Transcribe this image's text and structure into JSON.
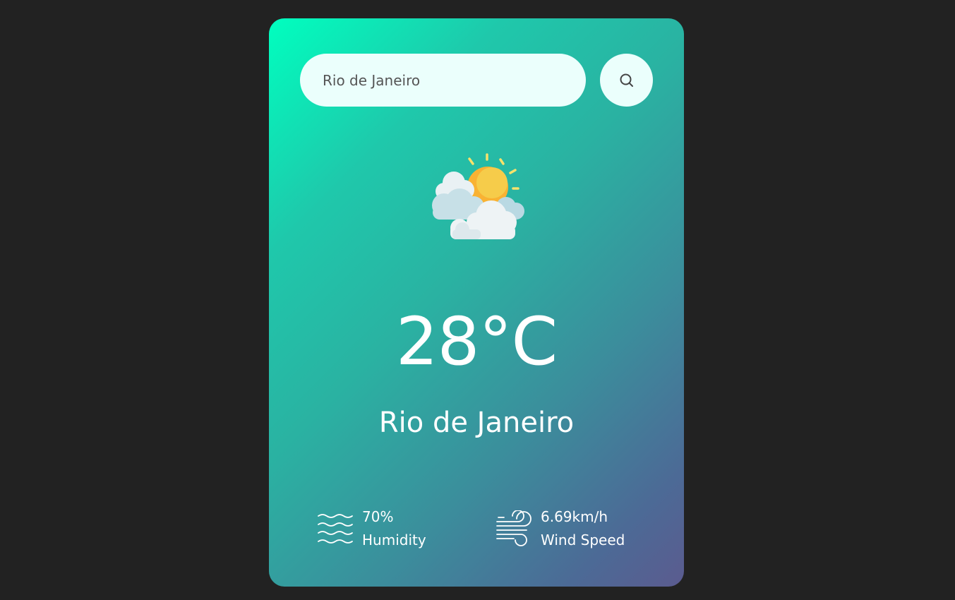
{
  "search": {
    "value": "Rio de Janeiro",
    "button_icon": "search-icon"
  },
  "weather": {
    "icon": "partly-cloudy-sun-icon",
    "temperature": "28°C",
    "city": "Rio de Janeiro"
  },
  "details": {
    "humidity": {
      "icon": "humidity-waves-icon",
      "value": "70%",
      "label": "Humidity"
    },
    "wind": {
      "icon": "wind-icon",
      "value": "6.69km/h",
      "label": "Wind Speed"
    }
  },
  "colors": {
    "page_background": "#222222",
    "card_gradient_start": "#00ffbf",
    "card_gradient_end": "#5b5b8f",
    "input_background": "#ebfffc",
    "text": "#ffffff"
  }
}
